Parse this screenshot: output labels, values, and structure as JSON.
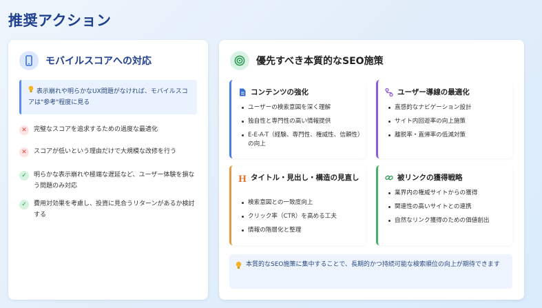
{
  "page": {
    "title": "推奨アクション"
  },
  "mobile": {
    "title": "モバイルスコアへの対応",
    "note": "表示崩れや明らかなUX問題がなければ、モバイルスコアは\"参考\"程度に見る",
    "items": [
      {
        "type": "x",
        "text": "完璧なスコアを追求するための過度な最適化"
      },
      {
        "type": "x",
        "text": "スコアが低いという理由だけで大規模な改修を行う"
      },
      {
        "type": "ok",
        "text": "明らかな表示崩れや極端な遅延など、ユーザー体験を損なう問題のみ対応"
      },
      {
        "type": "ok",
        "text": "費用対効果を考慮し、投資に見合うリターンがあるか検討する"
      }
    ]
  },
  "seo": {
    "title": "優先すべき本質的なSEO施策",
    "blocks": [
      {
        "title": "コンテンツの強化",
        "icon": "document-icon",
        "items": [
          "ユーザーの検索意図を深く理解",
          "独自性と専門性の高い情報提供",
          "E-E-A-T（経験、専門性、権威性、信頼性）の向上"
        ]
      },
      {
        "title": "ユーザー導線の最適化",
        "icon": "route-icon",
        "items": [
          "直感的なナビゲーション設計",
          "サイト内回遊率の向上施策",
          "離脱率・直帰率の低減対策"
        ]
      },
      {
        "title": "タイトル・見出し・構造の見直し",
        "icon": "heading-icon",
        "items": [
          "検索意図との一致度向上",
          "クリック率（CTR）を高める工夫",
          "情報の階層化と整理"
        ]
      },
      {
        "title": "被リンクの獲得戦略",
        "icon": "link-icon",
        "items": [
          "業界内の権威サイトからの獲得",
          "関連性の高いサイトとの連携",
          "自然なリンク獲得のための価値創出"
        ]
      }
    ],
    "footer": "本質的なSEO施策に集中することで、長期的かつ持続可能な検索順位の向上が期待できます"
  },
  "icons": {
    "heading_glyph": "H"
  },
  "colors": {
    "title": "#1f3f8f",
    "blue": "#4a7fe0",
    "purple": "#8d5bd7",
    "orange": "#e39a45",
    "green": "#45b06a",
    "error": "#e04848"
  }
}
